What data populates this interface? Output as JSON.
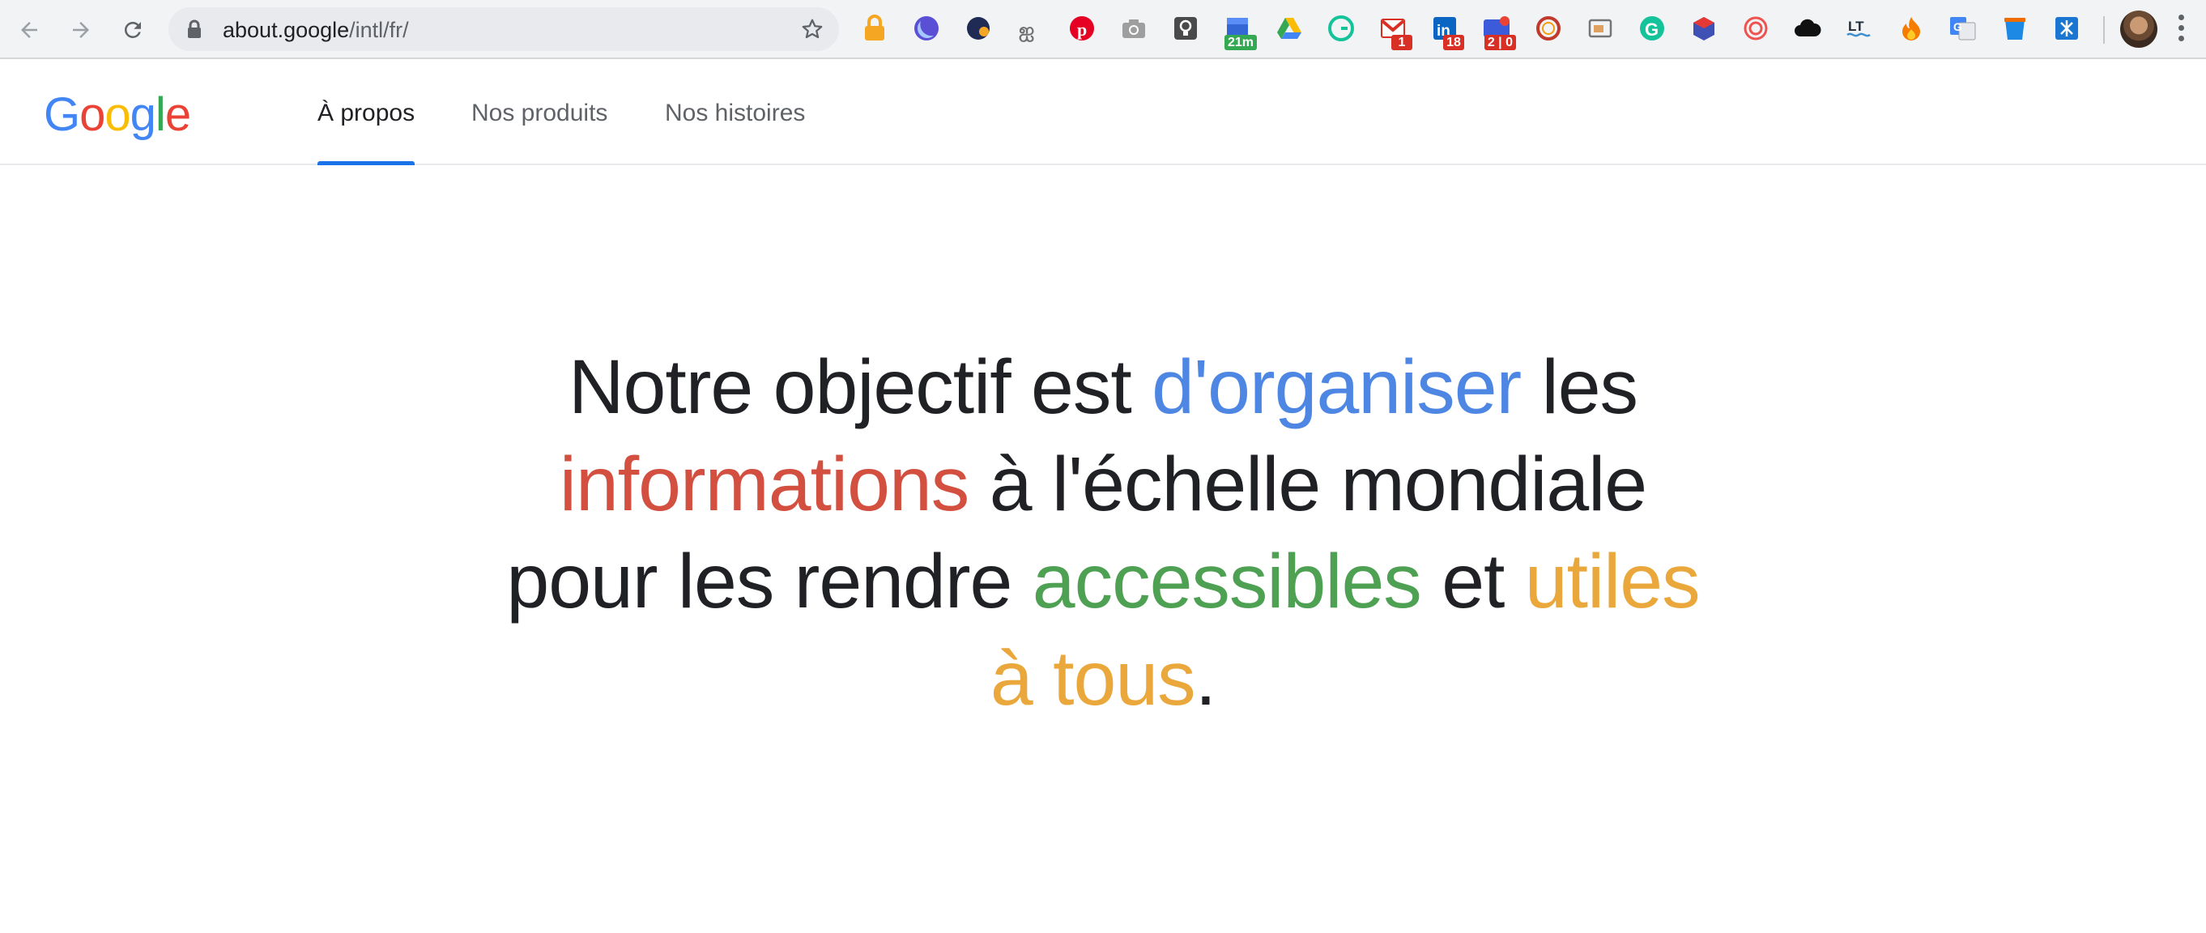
{
  "browser": {
    "url_host": "about.google",
    "url_path": "/intl/fr/",
    "extensions": [
      {
        "icon": "lock-extension-icon"
      },
      {
        "icon": "circle-blue-extension-icon"
      },
      {
        "icon": "circle-navy-extension-icon"
      },
      {
        "icon": "fire-extension-icon"
      },
      {
        "icon": "pinterest-icon"
      },
      {
        "icon": "camera-icon"
      },
      {
        "icon": "bulb-icon"
      },
      {
        "icon": "calendar-extension-icon",
        "badge": "21m",
        "badge_color": "#34a853"
      },
      {
        "icon": "google-drive-icon"
      },
      {
        "icon": "grammarly-green-icon"
      },
      {
        "icon": "gmail-icon",
        "badge": "1",
        "badge_color": "#d93025"
      },
      {
        "icon": "linkedin-icon",
        "badge": "18",
        "badge_color": "#d93025"
      },
      {
        "icon": "chat-extension-icon",
        "badge": "2 | 0",
        "badge_color": "#d93025"
      },
      {
        "icon": "ring-extension-icon"
      },
      {
        "icon": "window-extension-icon"
      },
      {
        "icon": "grammarly-icon"
      },
      {
        "icon": "cube-extension-icon"
      },
      {
        "icon": "swirl-extension-icon"
      },
      {
        "icon": "cloud-icon"
      },
      {
        "icon": "languagetool-icon"
      },
      {
        "icon": "flame-extension-icon"
      },
      {
        "icon": "google-translate-icon"
      },
      {
        "icon": "bucket-extension-icon"
      },
      {
        "icon": "translate-extension-icon"
      }
    ]
  },
  "header": {
    "logo": [
      "G",
      "o",
      "o",
      "g",
      "l",
      "e"
    ],
    "tabs": [
      {
        "label": "À propos",
        "active": true
      },
      {
        "label": "Nos produits",
        "active": false
      },
      {
        "label": "Nos histoires",
        "active": false
      }
    ]
  },
  "hero": {
    "p1": "Notre objectif est ",
    "w_organiser": "d'organiser",
    "p2": " les",
    "w_informations": "informations",
    "p3": " à l'échelle mondiale",
    "p4": "pour les rendre ",
    "w_accessibles": "accessibles",
    "p5": " et ",
    "w_utiles": "utiles",
    "w_tous": "à tous",
    "p6": "."
  },
  "colors": {
    "blue": "#4e86e4",
    "red": "#d34f40",
    "green": "#4ea053",
    "yellow": "#eaa83c",
    "active_tab_underline": "#1a73e8"
  }
}
